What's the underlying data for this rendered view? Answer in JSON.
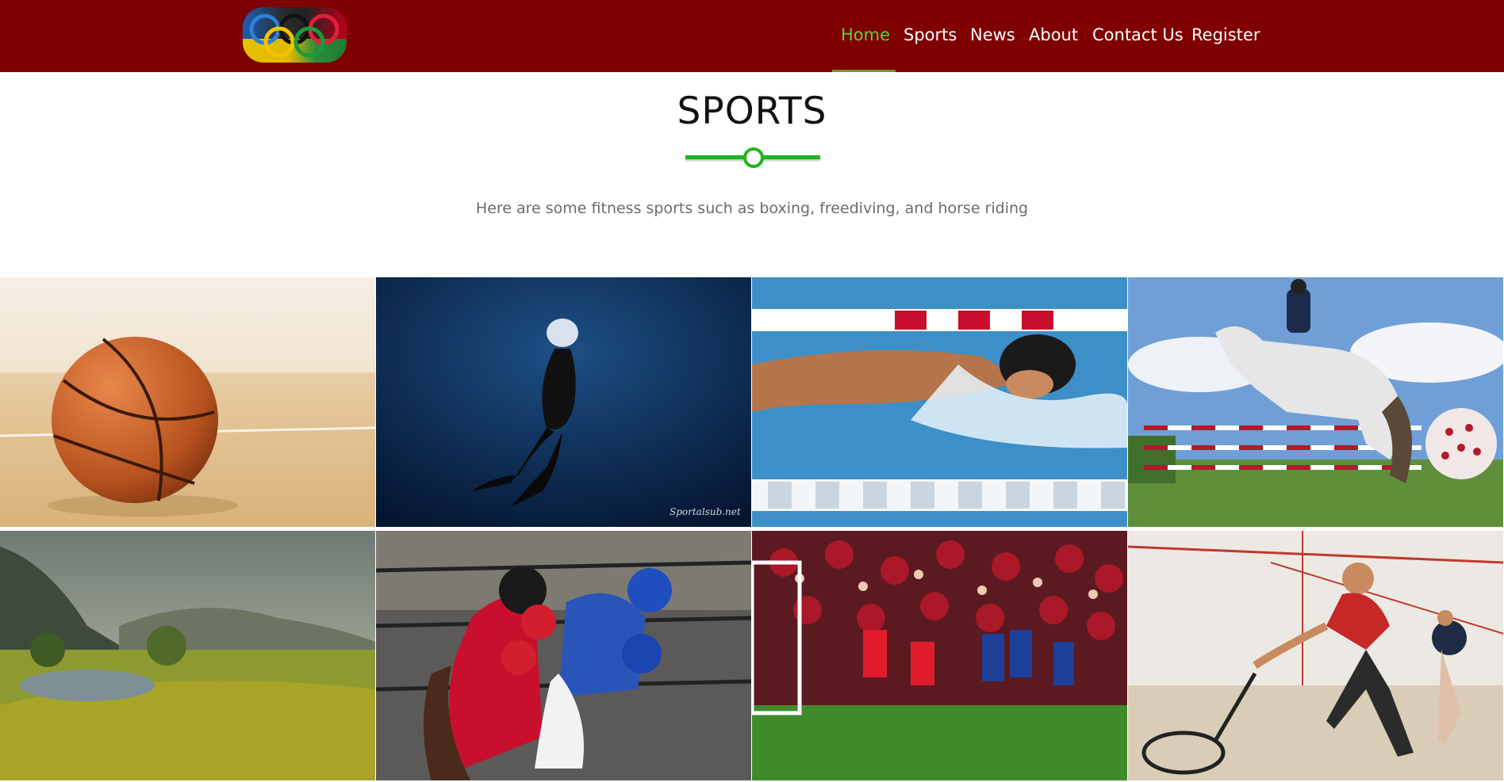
{
  "navbar": {
    "logo_icon": "olympic-rings-icon",
    "links": [
      "Home",
      "Sports",
      "News",
      "About",
      "Contact Us",
      "Register"
    ],
    "active": "Home",
    "colors": {
      "background": "#7f0000",
      "active": "#5fcf3a",
      "text": "#ffffff"
    }
  },
  "section": {
    "title": "SPORTS",
    "subtitle": "Here are some fitness sports such as boxing, freediving, and horse riding",
    "divider_color": "#1fb51f"
  },
  "gallery": {
    "tiles": [
      {
        "subject": "basketball-photo"
      },
      {
        "subject": "freediving-photo",
        "watermark": "Sportalsub.net"
      },
      {
        "subject": "swimming-photo"
      },
      {
        "subject": "horse-riding-photo"
      },
      {
        "subject": "golf-course-photo"
      },
      {
        "subject": "boxing-photo"
      },
      {
        "subject": "football-celebration-photo"
      },
      {
        "subject": "squash-photo"
      }
    ]
  }
}
